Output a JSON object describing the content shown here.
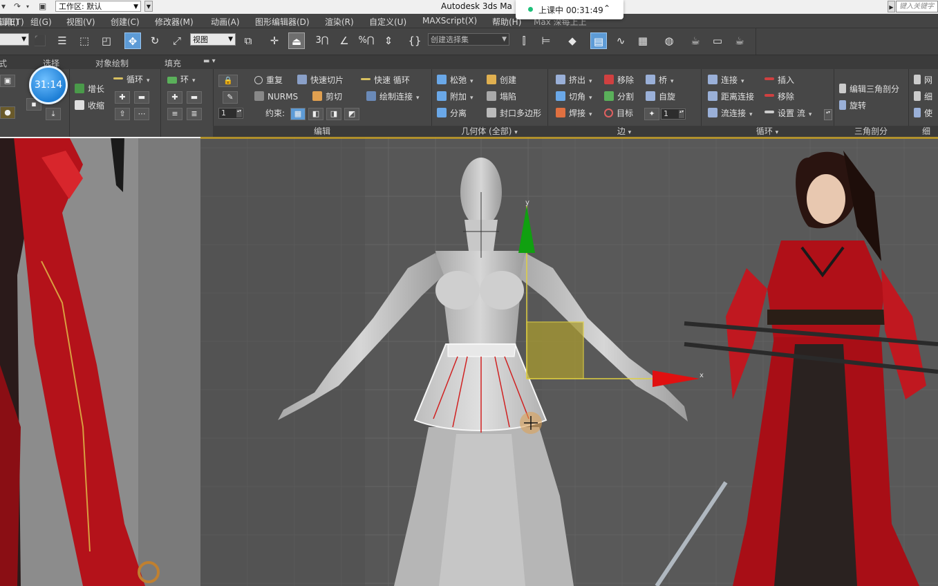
{
  "titlebar": {
    "workspace_label": "工作区: 默认",
    "app_title": "Autodesk 3ds Ma",
    "search_placeholder": "键入关键字"
  },
  "class_status": {
    "text": "上课中 00:31:49"
  },
  "menu": {
    "items": [
      "编辑(E)",
      "工具(T)",
      "组(G)",
      "视图(V)",
      "创建(C)",
      "修改器(M)",
      "动画(A)",
      "图形编辑器(D)",
      "渲染(R)",
      "自定义(U)",
      "MAXScript(X)",
      "帮助(H)",
      "Max 深每上上"
    ]
  },
  "toolbar": {
    "view_dropdown": "视图",
    "selection_set_dropdown": "创建选择集",
    "snap_label_3": "3",
    "percent_label": "%"
  },
  "ribbon_tabs": {
    "items": [
      "式",
      "选择",
      "对象绘制",
      "填充"
    ]
  },
  "timer_badge": {
    "time": "31:14"
  },
  "ribbon": {
    "left_partial": {
      "grow": "增长",
      "shrink": "收缩",
      "loop": "循环",
      "ring": "环"
    },
    "edit": {
      "label": "编辑",
      "repeat": "重复",
      "quick_slice": "快速切片",
      "quick_loop": "快速 循环",
      "nurms": "NURMS",
      "cut": "剪切",
      "paint_connect": "绘制连接",
      "constraint": "约束:",
      "spin_value": "1"
    },
    "geometry": {
      "label": "几何体 (全部)",
      "relax": "松弛",
      "create": "创建",
      "attach": "附加",
      "collapse": "塌陷",
      "detach": "分离",
      "cap_poly": "封口多边形"
    },
    "edges": {
      "label": "边",
      "extrude": "挤出",
      "remove": "移除",
      "bridge": "桥",
      "chamfer": "切角",
      "split": "分割",
      "spin": "自旋",
      "weld": "焊接",
      "target": "目标",
      "spin_value": "1"
    },
    "loops": {
      "label": "循环",
      "connect": "连接",
      "insert": "插入",
      "distance_connect": "距离连接",
      "remove": "移除",
      "flow_connect": "流连接",
      "set_flow": "设置 流"
    },
    "triangulation": {
      "label": "三角剖分",
      "edit_tri": "编辑三角剖分",
      "turn": "旋转"
    },
    "right_partial": {
      "mesh": "网",
      "subdiv": "细",
      "use": "使",
      "label": "细"
    }
  },
  "viewport": {
    "axis_y": "y",
    "axis_x": "x"
  }
}
